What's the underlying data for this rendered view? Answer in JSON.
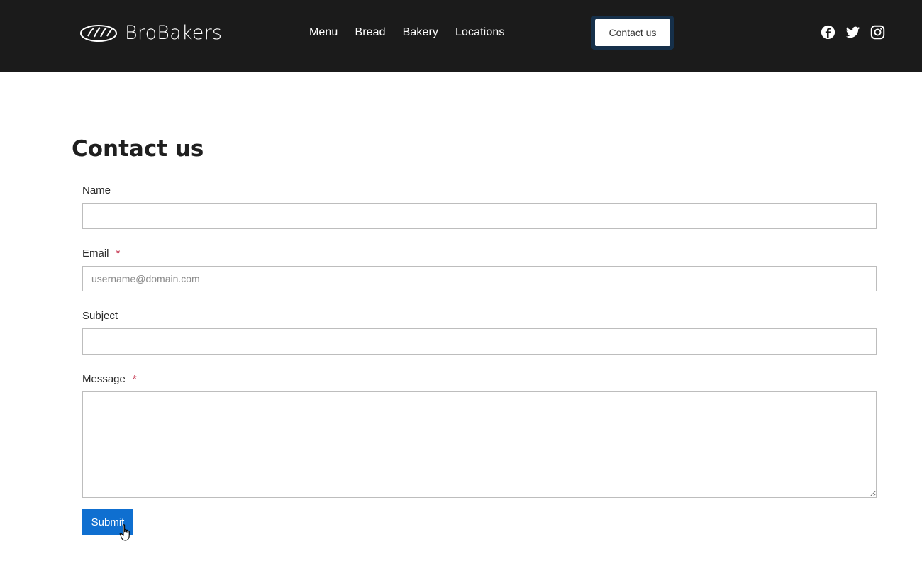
{
  "header": {
    "brand": "BroBakers",
    "nav": [
      {
        "label": "Menu"
      },
      {
        "label": "Bread"
      },
      {
        "label": "Bakery"
      },
      {
        "label": "Locations"
      }
    ],
    "cta_label": "Contact us",
    "social_icons": [
      "facebook-icon",
      "twitter-icon",
      "instagram-icon"
    ]
  },
  "main": {
    "title": "Contact us",
    "fields": {
      "name": {
        "label": "Name",
        "value": "",
        "placeholder": ""
      },
      "email": {
        "label": "Email",
        "required_mark": "*",
        "value": "",
        "placeholder": "username@domain.com"
      },
      "subject": {
        "label": "Subject",
        "value": "",
        "placeholder": ""
      },
      "message": {
        "label": "Message",
        "required_mark": "*",
        "value": "",
        "placeholder": ""
      }
    },
    "submit_label": "Submit"
  },
  "colors": {
    "header_bg": "#1b1b1b",
    "submit_bg": "#0f6fd0",
    "required": "#c4314b"
  }
}
